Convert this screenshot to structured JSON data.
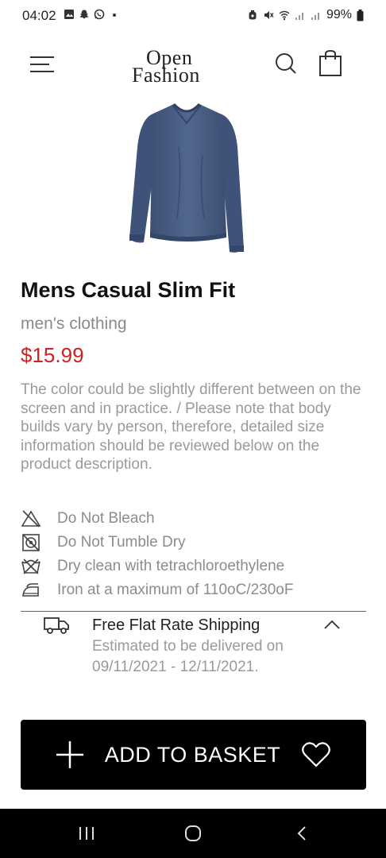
{
  "status_bar": {
    "time": "04:02",
    "battery": "99%"
  },
  "header": {
    "logo_line1": "Open",
    "logo_line2": "Fashion"
  },
  "product": {
    "title": "Mens Casual Slim Fit",
    "category": "men's clothing",
    "price": "$15.99",
    "description": "The color could be slightly different between on the screen and in practice. / Please note that body builds vary by person, therefore, detailed size information should be reviewed below on the product description.",
    "shirt_color": "#4a5f86"
  },
  "care": [
    {
      "icon": "no-bleach-icon",
      "text": "Do Not Bleach"
    },
    {
      "icon": "no-tumble-dry-icon",
      "text": "Do Not Tumble Dry"
    },
    {
      "icon": "dry-clean-icon",
      "text": "Dry clean with tetrachloroethylene"
    },
    {
      "icon": "iron-icon",
      "text": "Iron at a maximum of 110oC/230oF"
    }
  ],
  "shipping": {
    "title": "Free Flat Rate Shipping",
    "line1": "Estimated to be delivered on",
    "line2": "09/11/2021 - 12/11/2021."
  },
  "cta": {
    "label": "ADD TO BASKET"
  },
  "colors": {
    "price": "#d21f1f",
    "button_bg": "#000000"
  }
}
